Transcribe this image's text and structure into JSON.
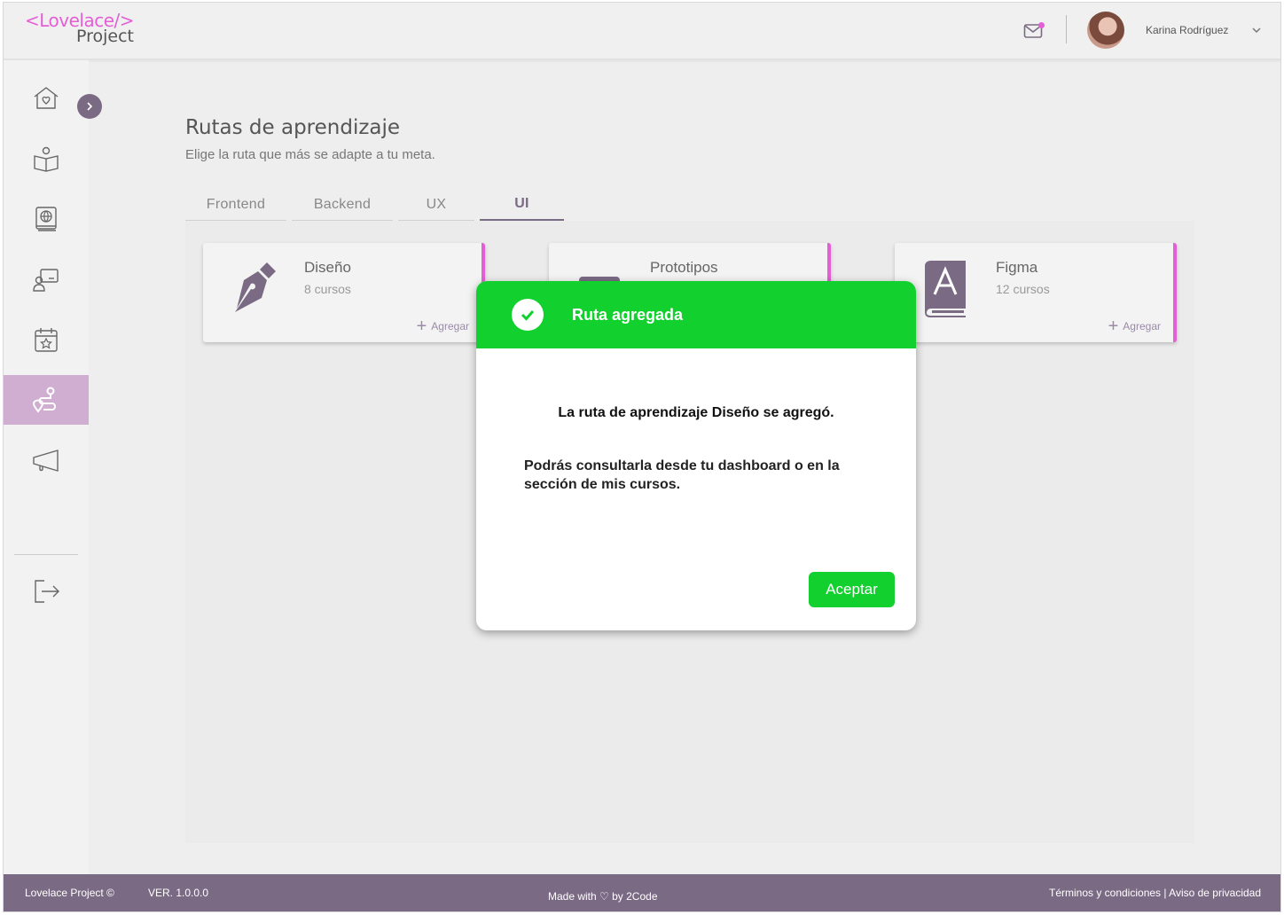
{
  "header": {
    "logo_top": "<Lovelace/>",
    "logo_bottom": "Project",
    "user_name": "Karina Rodríguez"
  },
  "sidebar": {
    "items": [
      {
        "name": "home",
        "icon": "home-heart-icon"
      },
      {
        "name": "courses",
        "icon": "open-book-icon"
      },
      {
        "name": "resources",
        "icon": "globe-book-icon"
      },
      {
        "name": "mentoring",
        "icon": "person-board-icon"
      },
      {
        "name": "events",
        "icon": "calendar-star-icon"
      },
      {
        "name": "routes",
        "icon": "route-pin-icon",
        "active": true
      },
      {
        "name": "announcements",
        "icon": "megaphone-icon"
      },
      {
        "name": "logout",
        "icon": "logout-icon"
      }
    ]
  },
  "main": {
    "title": "Rutas de aprendizaje",
    "subtitle": "Elige la ruta que más se adapte a tu meta.",
    "tabs": [
      {
        "label": "Frontend"
      },
      {
        "label": "Backend"
      },
      {
        "label": "UX"
      },
      {
        "label": "UI",
        "active": true
      }
    ],
    "cards": [
      {
        "name": "Diseño",
        "count": "8 cursos",
        "add": "Agregar",
        "icon": "pen-nib-icon"
      },
      {
        "name": "Prototipos",
        "count": "",
        "add": "",
        "icon": "prototype-icon"
      },
      {
        "name": "Figma",
        "count": "12 cursos",
        "add": "Agregar",
        "icon": "font-book-icon"
      }
    ]
  },
  "modal": {
    "title": "Ruta agregada",
    "message_prefix": "La ruta de aprendizaje ",
    "message_route": "Diseño",
    "message_suffix": " se agregó.",
    "detail": "Podrás consultarla desde tu dashboard o en la sección de mis cursos.",
    "button": "Aceptar"
  },
  "footer": {
    "brand": "Lovelace Project ©",
    "version": "VER. 1.0.0.0",
    "made_with": "Made with ♡ by 2Code",
    "links": "Términos y condiciones | Aviso de privacidad"
  },
  "colors": {
    "accent_pink": "#e45fd6",
    "brand_purple": "#7b6a84",
    "success_green": "#12d12e",
    "active_sidebar": "#d0aed1"
  }
}
